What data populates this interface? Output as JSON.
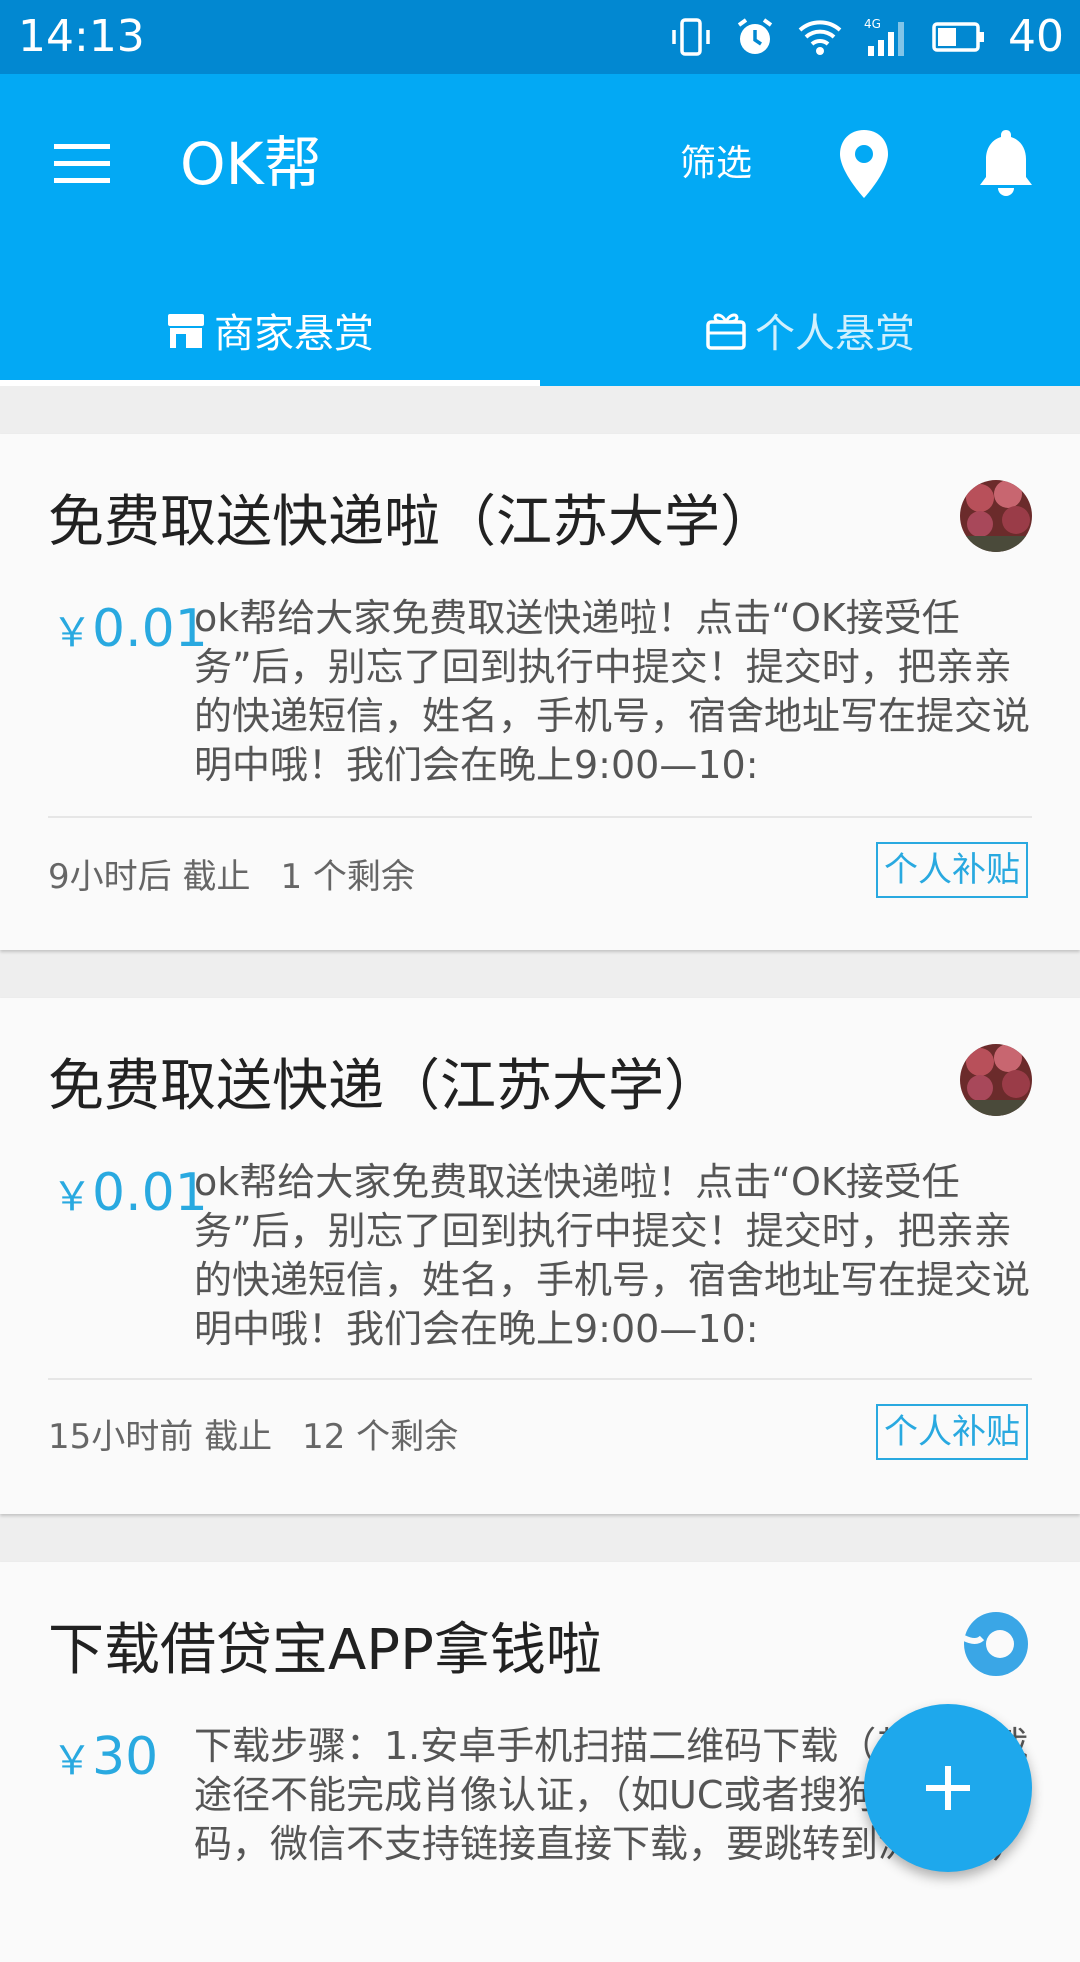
{
  "status_bar": {
    "time": "14:13",
    "battery": "40",
    "icons": [
      "vibrate-icon",
      "alarm-icon",
      "wifi-icon",
      "signal-4g-icon",
      "battery-icon"
    ]
  },
  "app_bar": {
    "title": "OK帮",
    "filter_label": "筛选",
    "color": "#03a9f4"
  },
  "tabs": [
    {
      "label": "商家悬赏",
      "icon": "store-icon",
      "selected": true
    },
    {
      "label": "个人悬赏",
      "icon": "gift-icon",
      "selected": false
    }
  ],
  "cards": [
    {
      "title": "免费取送快递啦（江苏大学）",
      "price_symbol": "￥",
      "price": "0.01",
      "description": "ok帮给大家免费取送快递啦！点击“OK接受任务”后，别忘了回到执行中提交！提交时，把亲亲的快递短信，姓名，手机号，宿舍地址写在提交说明中哦！我们会在晚上9:00—10:",
      "deadline": "9小时后 截止",
      "remaining": "1 个剩余",
      "tag": "个人补贴"
    },
    {
      "title": "免费取送快递（江苏大学）",
      "price_symbol": "￥",
      "price": "0.01",
      "description": "ok帮给大家免费取送快递啦！点击“OK接受任务”后，别忘了回到执行中提交！提交时，把亲亲的快递短信，姓名，手机号，宿舍地址写在提交说明中哦！我们会在晚上9:00—10:",
      "deadline": "15小时前 截止",
      "remaining": "12 个剩余",
      "tag": "个人补贴"
    },
    {
      "title": "下载借贷宝APP拿钱啦",
      "price_symbol": "￥",
      "price": "30",
      "description": "下载步骤：1.安卓手机扫描二维码下载（其他下载途径不能完成肖像认证，（如UC或者搜狗输入法扫码，微信不支持链接直接下载，要跳转到浏览器）"
    }
  ],
  "accent_color": "#29a9e0"
}
